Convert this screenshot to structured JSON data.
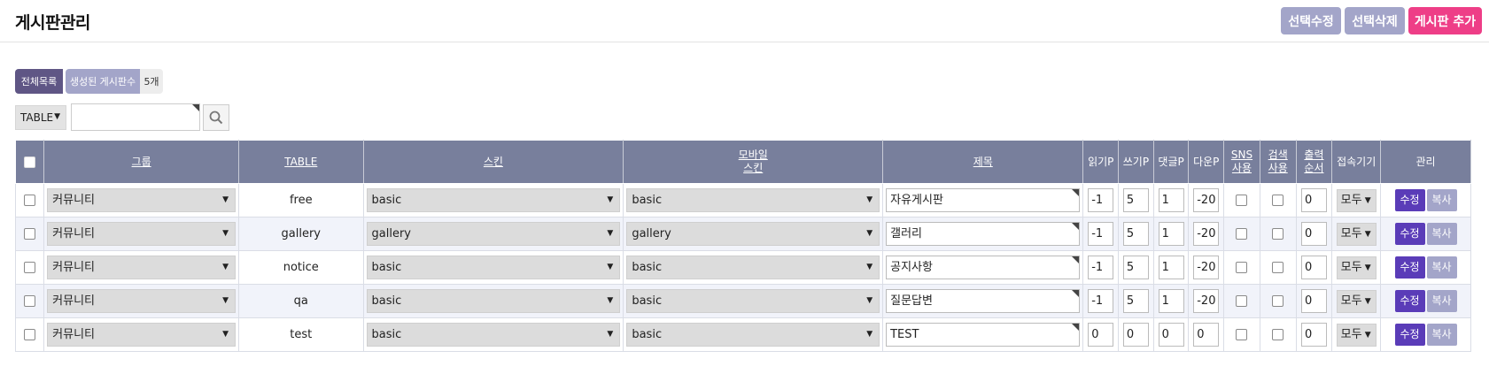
{
  "header": {
    "title": "게시판관리",
    "buttons": {
      "edit_selected": "선택수정",
      "delete_selected": "선택삭제",
      "add_board": "게시판 추가"
    }
  },
  "summary": {
    "all_list": "전체목록",
    "count_label": "생성된 게시판수",
    "count_value": "5개"
  },
  "search": {
    "field": "TABLE",
    "value": ""
  },
  "table": {
    "columns": [
      "그룹",
      "TABLE",
      "스킨",
      "모바일",
      "스킨",
      "제목",
      "읽기P",
      "쓰기P",
      "댓글P",
      "다운P",
      "SNS",
      "사용",
      "검색",
      "사용",
      "출력",
      "순서",
      "접속기기",
      "관리"
    ],
    "rows": [
      {
        "group": "커뮤니티",
        "table": "free",
        "skin": "basic",
        "mobile_skin": "basic",
        "subject": "자유게시판",
        "read": "-1",
        "write": "5",
        "comment": "1",
        "download": "-20",
        "order": "0",
        "device": "모두",
        "edit": "수정",
        "copy": "복사"
      },
      {
        "group": "커뮤니티",
        "table": "gallery",
        "skin": "gallery",
        "mobile_skin": "gallery",
        "subject": "갤러리",
        "read": "-1",
        "write": "5",
        "comment": "1",
        "download": "-20",
        "order": "0",
        "device": "모두",
        "edit": "수정",
        "copy": "복사"
      },
      {
        "group": "커뮤니티",
        "table": "notice",
        "skin": "basic",
        "mobile_skin": "basic",
        "subject": "공지사항",
        "read": "-1",
        "write": "5",
        "comment": "1",
        "download": "-20",
        "order": "0",
        "device": "모두",
        "edit": "수정",
        "copy": "복사"
      },
      {
        "group": "커뮤니티",
        "table": "qa",
        "skin": "basic",
        "mobile_skin": "basic",
        "subject": "질문답변",
        "read": "-1",
        "write": "5",
        "comment": "1",
        "download": "-20",
        "order": "0",
        "device": "모두",
        "edit": "수정",
        "copy": "복사"
      },
      {
        "group": "커뮤니티",
        "table": "test",
        "skin": "basic",
        "mobile_skin": "basic",
        "subject": "TEST",
        "read": "0",
        "write": "0",
        "comment": "0",
        "download": "0",
        "order": "0",
        "device": "모두",
        "edit": "수정",
        "copy": "복사"
      }
    ]
  },
  "colors": {
    "header_bg": "#787f9c",
    "accent_purple": "#5a3cb8",
    "accent_pink": "#ee3e87",
    "muted_button": "#a3a5c9",
    "tab_dark": "#5f5685"
  },
  "icons": {
    "search": "search-icon",
    "dropdown": "dropdown-arrow-icon"
  }
}
